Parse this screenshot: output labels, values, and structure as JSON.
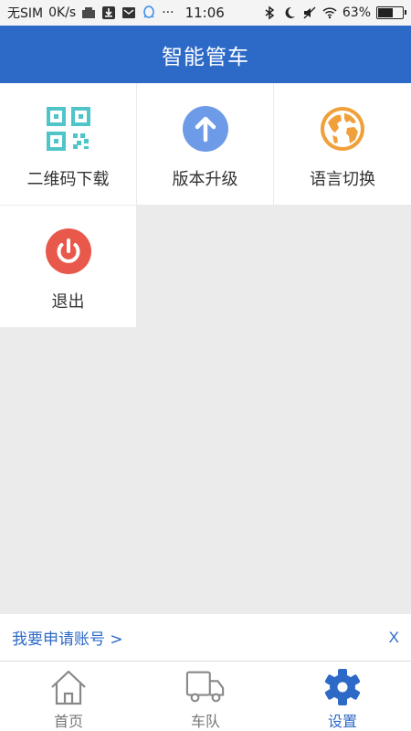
{
  "statusbar": {
    "carrier": "无SIM",
    "speed": "0K/s",
    "dots": "···",
    "time": "11:06",
    "battery": "63%",
    "battery_level": 0.63
  },
  "header": {
    "title": "智能管车"
  },
  "menu": {
    "items": [
      {
        "label": "二维码下载",
        "icon": "qr-code-icon",
        "color": "#4fc4c9"
      },
      {
        "label": "版本升级",
        "icon": "arrow-up-icon",
        "color": "#6d9be8"
      },
      {
        "label": "语言切换",
        "icon": "globe-icon",
        "color": "#f0a03a"
      },
      {
        "label": "退出",
        "icon": "power-icon",
        "color": "#e8594c"
      }
    ]
  },
  "banner": {
    "link_text": "我要申请账号 >",
    "close_text": "X"
  },
  "bottom_nav": {
    "items": [
      {
        "label": "首页",
        "icon": "home-icon"
      },
      {
        "label": "车队",
        "icon": "truck-icon"
      },
      {
        "label": "设置",
        "icon": "gear-icon",
        "active": true
      }
    ]
  },
  "colors": {
    "primary": "#2d6ac7",
    "background": "#ebebeb"
  }
}
